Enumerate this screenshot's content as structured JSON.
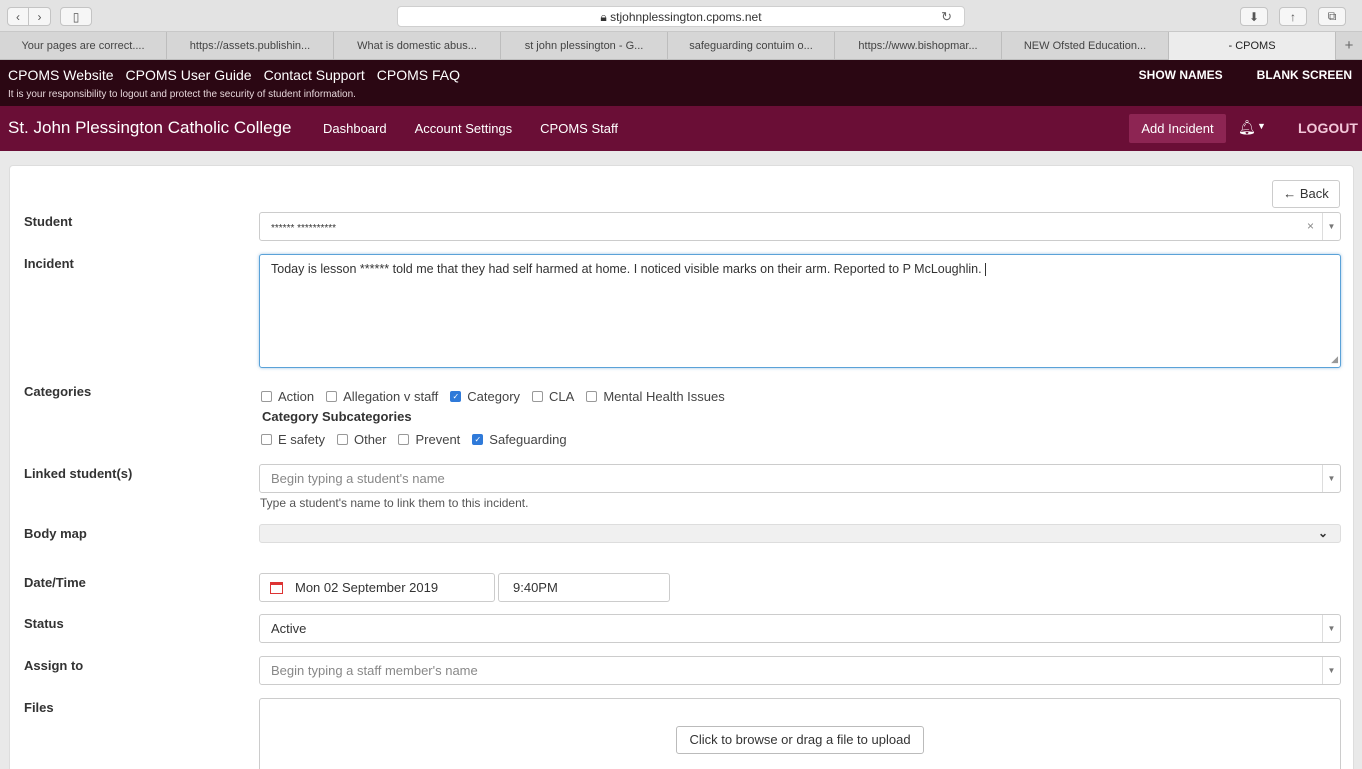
{
  "browser": {
    "url": "stjohnplessington.cpoms.net",
    "tabs": [
      "Your pages are correct....",
      "https://assets.publishin...",
      "What is domestic abus...",
      "st john plessington - G...",
      "safeguarding contuim o...",
      "https://www.bishopmar...",
      "NEW Ofsted Education...",
      "- CPOMS"
    ]
  },
  "topbar": {
    "links": [
      "CPOMS Website",
      "CPOMS User Guide",
      "Contact Support",
      "CPOMS FAQ"
    ],
    "note": "It is your responsibility to logout and protect the security of student information.",
    "show_names": "SHOW NAMES",
    "blank_screen": "BLANK SCREEN"
  },
  "nav": {
    "brand": "St. John Plessington Catholic College",
    "links": [
      "Dashboard",
      "Account Settings",
      "CPOMS Staff"
    ],
    "add_incident": "Add Incident",
    "logout": "LOGOUT"
  },
  "form": {
    "back": "Back",
    "labels": {
      "student": "Student",
      "incident": "Incident",
      "categories": "Categories",
      "linked": "Linked student(s)",
      "bodymap": "Body map",
      "datetime": "Date/Time",
      "status": "Status",
      "assign": "Assign to",
      "files": "Files"
    },
    "student_value": "****** **********",
    "incident_text": "Today is lesson ****** told me that they had self harmed at home.  I noticed visible marks on their arm. Reported to P McLoughlin.",
    "categories": [
      {
        "label": "Action",
        "checked": false
      },
      {
        "label": "Allegation v staff",
        "checked": false
      },
      {
        "label": "Category",
        "checked": true
      },
      {
        "label": "CLA",
        "checked": false
      },
      {
        "label": "Mental Health Issues",
        "checked": false
      }
    ],
    "subcategories_title": "Category Subcategories",
    "subcategories": [
      {
        "label": "E safety",
        "checked": false
      },
      {
        "label": "Other",
        "checked": false
      },
      {
        "label": "Prevent",
        "checked": false
      },
      {
        "label": "Safeguarding",
        "checked": true
      }
    ],
    "linked_placeholder": "Begin typing a student's name",
    "linked_help": "Type a student's name to link them to this incident.",
    "date": "Mon 02 September 2019",
    "time": "9:40PM",
    "status_value": "Active",
    "assign_placeholder": "Begin typing a staff member's name",
    "upload_label": "Click to browse or drag a file to upload"
  }
}
